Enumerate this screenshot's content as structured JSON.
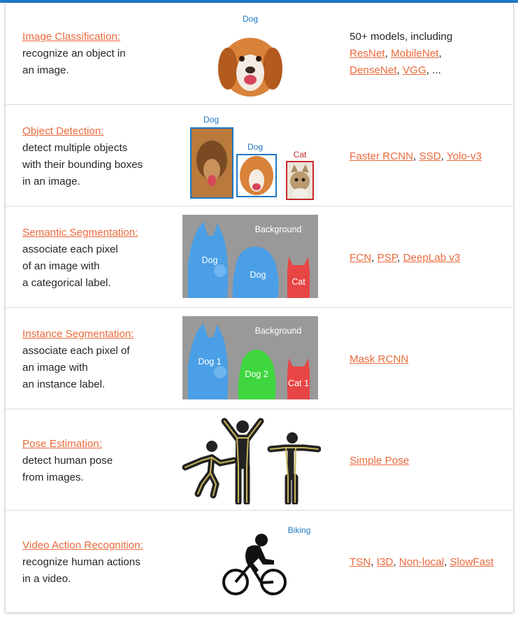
{
  "rows": [
    {
      "task": "Image Classification:",
      "desc": [
        "recognize an object in",
        "an image."
      ],
      "models_prefix": "50+ models, including",
      "models": [
        "ResNet",
        "MobileNet",
        "DenseNet",
        "VGG"
      ],
      "models_suffix": "...",
      "labels": [
        "Dog"
      ]
    },
    {
      "task": "Object Detection:",
      "desc": [
        "detect multiple objects",
        "with their bounding boxes",
        "in an image."
      ],
      "models": [
        "Faster RCNN",
        "SSD",
        "Yolo-v3"
      ],
      "labels": [
        "Dog",
        "Dog",
        "Cat"
      ]
    },
    {
      "task": "Semantic Segmentation:",
      "desc": [
        "associate each pixel",
        "of an image with",
        "a categorical label."
      ],
      "models": [
        "FCN",
        "PSP",
        "DeepLab v3"
      ],
      "labels": [
        "Background",
        "Dog",
        "Dog",
        "Cat"
      ]
    },
    {
      "task": "Instance Segmentation:",
      "desc": [
        "associate each pixel of",
        "an image with",
        "an instance label."
      ],
      "models": [
        "Mask RCNN"
      ],
      "labels": [
        "Background",
        "Dog 1",
        "Dog 2",
        "Cat 1"
      ]
    },
    {
      "task": "Pose Estimation:",
      "desc": [
        "detect human pose",
        "from images."
      ],
      "models": [
        "Simple Pose"
      ],
      "labels": []
    },
    {
      "task": "Video Action Recognition:",
      "desc": [
        "recognize human actions",
        "in a video."
      ],
      "models": [
        "TSN",
        "I3D",
        "Non-local",
        "SlowFast"
      ],
      "labels": [
        "Biking"
      ]
    }
  ],
  "colors": {
    "link": "#ea6a3c",
    "box_dog": "#1d77c4",
    "box_cat": "#c62828",
    "seg_background": "#999999",
    "seg_dog": "#4a9fe6",
    "seg_dog2": "#3fd63f",
    "seg_cat": "#e84545"
  },
  "icons": [
    "dog-photo",
    "cat-photo",
    "pose-figure-icon",
    "biking-icon"
  ]
}
